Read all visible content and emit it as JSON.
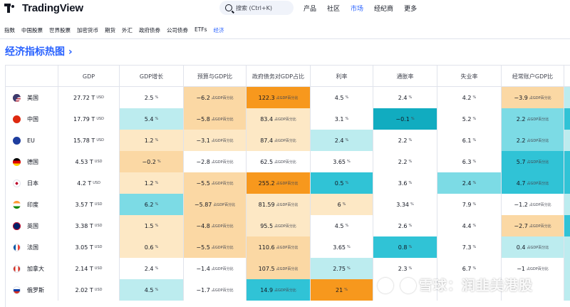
{
  "header": {
    "logo_text": "TradingView",
    "search_placeholder": "搜索 (Ctrl+K)",
    "nav": [
      "产品",
      "社区",
      "市场",
      "经纪商",
      "更多"
    ],
    "active_nav": "市场"
  },
  "subnav": {
    "items": [
      "指数",
      "中国股票",
      "世界股票",
      "加密货币",
      "期货",
      "外汇",
      "政府债券",
      "公司债券",
      "ETFs",
      "经济"
    ],
    "active": "经济"
  },
  "section_title": "经济指标热图",
  "table": {
    "columns": [
      "GDP",
      "GDP增长",
      "预算与GDP比",
      "政府债务对GDP占比",
      "利率",
      "通胀率",
      "失业率",
      "经常账户GDP比"
    ],
    "rows": [
      {
        "country": "美国",
        "gdp": "27.72 T",
        "gdp_unit": "USD",
        "growth": "2.5",
        "budget": "−6.2",
        "debt": "122.3",
        "rate": "4.5",
        "infl": "2.4",
        "unemp": "4.2",
        "ca": "−3.9",
        "colors": [
          "c-white",
          "c-white",
          "c-peach",
          "c-dorange",
          "c-white",
          "c-white",
          "c-white",
          "c-peach"
        ]
      },
      {
        "country": "中国",
        "gdp": "17.79 T",
        "gdp_unit": "USD",
        "growth": "5.4",
        "budget": "−5.8",
        "debt": "83.4",
        "rate": "3.1",
        "infl": "−0.1",
        "unemp": "5.2",
        "ca": "2.2",
        "colors": [
          "c-white",
          "c-lblue",
          "c-peach",
          "c-cream",
          "c-white",
          "c-dblue",
          "c-white",
          "c-mblue"
        ]
      },
      {
        "country": "EU",
        "gdp": "15.78 T",
        "gdp_unit": "USD",
        "growth": "1.2",
        "budget": "−3.1",
        "debt": "87.4",
        "rate": "2.4",
        "infl": "2.2",
        "unemp": "6.1",
        "ca": "2.2",
        "colors": [
          "c-white",
          "c-cream",
          "c-cream",
          "c-cream",
          "c-lblue",
          "c-white",
          "c-white",
          "c-mblue"
        ]
      },
      {
        "country": "德国",
        "gdp": "4.53 T",
        "gdp_unit": "USD",
        "growth": "−0.2",
        "budget": "−2.8",
        "debt": "62.5",
        "rate": "3.65",
        "infl": "2.2",
        "unemp": "6.3",
        "ca": "5.7",
        "colors": [
          "c-white",
          "c-peach",
          "c-white",
          "c-white",
          "c-white",
          "c-white",
          "c-white",
          "c-blue"
        ]
      },
      {
        "country": "日本",
        "gdp": "4.2 T",
        "gdp_unit": "USD",
        "growth": "1.2",
        "budget": "−5.5",
        "debt": "255.2",
        "rate": "0.5",
        "infl": "3.6",
        "unemp": "2.4",
        "ca": "4.7",
        "colors": [
          "c-white",
          "c-cream",
          "c-peach",
          "c-dorange",
          "c-blue",
          "c-white",
          "c-mblue",
          "c-blue"
        ]
      },
      {
        "country": "印度",
        "gdp": "3.57 T",
        "gdp_unit": "USD",
        "growth": "6.2",
        "budget": "−5.87",
        "debt": "81.59",
        "rate": "6",
        "infl": "3.34",
        "unemp": "7.9",
        "ca": "−1.2",
        "colors": [
          "c-white",
          "c-mblue",
          "c-peach",
          "c-cream",
          "c-cream",
          "c-white",
          "c-white",
          "c-white"
        ]
      },
      {
        "country": "英国",
        "gdp": "3.38 T",
        "gdp_unit": "USD",
        "growth": "1.5",
        "budget": "−4.8",
        "debt": "95.5",
        "rate": "4.5",
        "infl": "2.6",
        "unemp": "4.4",
        "ca": "−2.7",
        "colors": [
          "c-white",
          "c-cream",
          "c-peach",
          "c-cream",
          "c-white",
          "c-white",
          "c-white",
          "c-peach"
        ]
      },
      {
        "country": "法国",
        "gdp": "3.05 T",
        "gdp_unit": "USD",
        "growth": "0.6",
        "budget": "−5.5",
        "debt": "110.6",
        "rate": "3.65",
        "infl": "0.8",
        "unemp": "7.3",
        "ca": "0.4",
        "colors": [
          "c-white",
          "c-cream",
          "c-peach",
          "c-peach",
          "c-white",
          "c-blue",
          "c-white",
          "c-lblue"
        ]
      },
      {
        "country": "加拿大",
        "gdp": "2.14 T",
        "gdp_unit": "USD",
        "growth": "2.4",
        "budget": "−1.4",
        "debt": "107.5",
        "rate": "2.75",
        "infl": "2.3",
        "unemp": "6.7",
        "ca": "−1",
        "colors": [
          "c-white",
          "c-white",
          "c-white",
          "c-peach",
          "c-lblue",
          "c-white",
          "c-white",
          "c-white"
        ]
      },
      {
        "country": "俄罗斯",
        "gdp": "2.02 T",
        "gdp_unit": "USD",
        "growth": "4.5",
        "budget": "−1.7",
        "debt": "14.9",
        "rate": "21",
        "infl": "",
        "unemp": "",
        "ca": "",
        "colors": [
          "c-white",
          "c-lblue",
          "c-white",
          "c-blue",
          "c-dorange",
          "c-white",
          "c-white",
          "c-white"
        ]
      }
    ],
    "pct_unit": "%",
    "gdp_pct_unit": "占GDP百分比"
  },
  "watermark": "雪球：润韭美港股"
}
